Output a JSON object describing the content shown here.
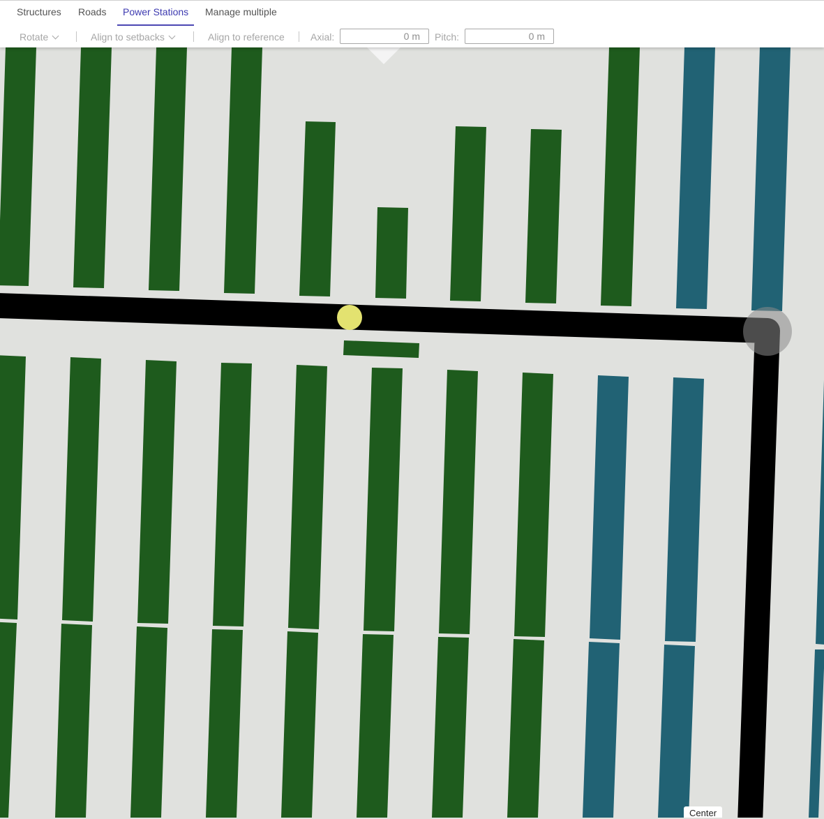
{
  "tabs": [
    {
      "label": "Structures"
    },
    {
      "label": "Roads"
    },
    {
      "label": "Power Stations"
    },
    {
      "label": "Manage multiple"
    }
  ],
  "toolbar": {
    "rotate_label": "Rotate",
    "align_setbacks_label": "Align to setbacks",
    "align_reference_label": "Align to reference",
    "axial_label": "Axial:",
    "axial_value": "0 m",
    "pitch_label": "Pitch:",
    "pitch_value": "0 m"
  },
  "map": {
    "center_label": "Center",
    "colors": {
      "background": "#e0e1de",
      "table_green": "#1e5b1d",
      "table_blue": "#216274",
      "road": "#000000",
      "selected_marker": "#e3e270",
      "road_node": "#8a8a8a"
    }
  }
}
